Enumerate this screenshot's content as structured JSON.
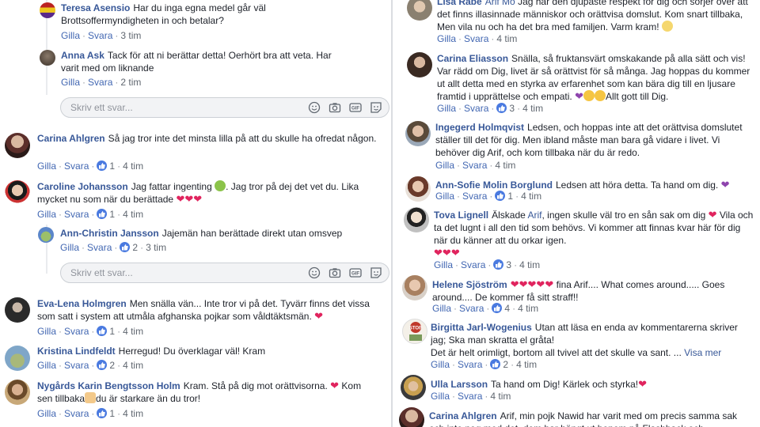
{
  "left": {
    "comments": [
      {
        "name": "Teresa Asensio",
        "text": "Har du inga egna medel går väl Brottsoffermyndigheten in och betalar?",
        "like": "Gilla",
        "reply": "Svara",
        "time": "3 tim"
      },
      {
        "name": "Anna Ask",
        "text": "Tack för att ni berättar detta! Oerhört bra att veta. Har varit med om liknande",
        "like": "Gilla",
        "reply": "Svara",
        "time": "2 tim"
      },
      {
        "name": "Carina Ahlgren",
        "text": "Så jag tror inte det minsta lilla på att du skulle ha ofredat någon.",
        "like": "Gilla",
        "reply": "Svara",
        "count": "1",
        "time": "4 tim"
      },
      {
        "name": "Caroline Johansson",
        "text1": "Jag fattar ingenting",
        "text2": ". Jag tror på dej det vet du. Lika mycket nu som när du berättade",
        "like": "Gilla",
        "reply": "Svara",
        "count": "1",
        "time": "4 tim"
      },
      {
        "name": "Ann-Christin Jansson",
        "text": "Jajemän han berättade direkt utan omsvep",
        "like": "Gilla",
        "reply": "Svara",
        "count": "2",
        "time": "3 tim"
      },
      {
        "name": "Eva-Lena Holmgren",
        "text": "Men snälla vän... Inte tror vi på det. Tyvärr finns det vissa som satt i system att utmåla afghanska pojkar som våldtäktsmän.",
        "like": "Gilla",
        "reply": "Svara",
        "count": "1",
        "time": "4 tim"
      },
      {
        "name": "Kristina Lindfeldt",
        "text": "Herregud! Du överklagar väl! Kram",
        "like": "Gilla",
        "reply": "Svara",
        "count": "2",
        "time": "4 tim"
      },
      {
        "name": "Nygårds Karin Bengtsson Holm",
        "text1": "Kram. Stå på dig mot orättvisorna.",
        "text2": "Kom sen tillbaka",
        "text3": "du är starkare än du tror!",
        "like": "Gilla",
        "reply": "Svara",
        "count": "1",
        "time": "4 tim"
      }
    ],
    "reply_placeholder": "Skriv ett svar..."
  },
  "right": {
    "comments": [
      {
        "name": "Lisa Rabe",
        "tag": "Arif Mo",
        "text": "Jag har den djupaste respekt för dig och sörjer över att det finns illasinnade människor och orättvisa domslut. Kom snart tillbaka, Men vila nu och ha det bra med familjen. Varm kram!",
        "like": "Gilla",
        "reply": "Svara",
        "time": "4 tim"
      },
      {
        "name": "Carina Eliasson",
        "text": "Snälla, så fruktansvärt omskakande på alla sätt och vis! Var rädd om Dig, livet är så orättvist för så många. Jag hoppas du kommer ut allt detta med en styrka av erfarenhet som kan bära dig till en ljusare framtid i upprättelse och empati.",
        "text2": "Allt gott till Dig.",
        "like": "Gilla",
        "reply": "Svara",
        "count": "3",
        "time": "4 tim"
      },
      {
        "name": "Ingegerd Holmqvist",
        "text": "Ledsen, och hoppas inte att det orättvisa domslutet ställer till det för dig. Men ibland måste man bara gå vidare i livet. Vi behöver dig Arif, och kom tillbaka när du är redo.",
        "like": "Gilla",
        "reply": "Svara",
        "time": "4 tim"
      },
      {
        "name": "Ann-Sofie Molin Borglund",
        "text": "Ledsen att höra detta. Ta hand om dig.",
        "like": "Gilla",
        "reply": "Svara",
        "count": "1",
        "time": "4 tim"
      },
      {
        "name": "Tova Lignell",
        "text1": "Älskade",
        "tag": "Arif",
        "text2": ", ingen skulle väl tro en sån sak om dig",
        "text3": "Vila och ta det lugnt i all den tid som behövs. Vi kommer att finnas kvar här för dig när du känner att du orkar igen.",
        "like": "Gilla",
        "reply": "Svara",
        "count": "3",
        "time": "4 tim"
      },
      {
        "name": "Helene Sjöström",
        "text1": "fina Arif.... What comes around..... Goes around.... De kommer få sitt straff!!",
        "like": "Gilla",
        "reply": "Svara",
        "count": "4",
        "time": "4 tim"
      },
      {
        "name": "Birgitta Jarl-Wogenius",
        "text": "Utan att läsa en enda av kommentarerna skriver jag; Ska man skratta el gråta!",
        "text2": "Det är helt orimligt, bortom all tvivel att det skulle va sant. ...",
        "more": "Visa mer",
        "like": "Gilla",
        "reply": "Svara",
        "count": "2",
        "time": "4 tim"
      },
      {
        "name": "Ulla Larsson",
        "text": "Ta hand om Dig! Kärlek och styrka!",
        "like": "Gilla",
        "reply": "Svara",
        "time": "4 tim"
      },
      {
        "name": "Carina Ahlgren",
        "text": "Arif, min pojk Nawid har varit med om precis samma sak och inte nog med det, dom har hängt ut honom på Flashback och"
      }
    ]
  },
  "colors": {
    "name": "#385898",
    "link": "#4267b2",
    "meta": "#606770",
    "heart": "#e0245e",
    "like": "#4a7ae0"
  }
}
